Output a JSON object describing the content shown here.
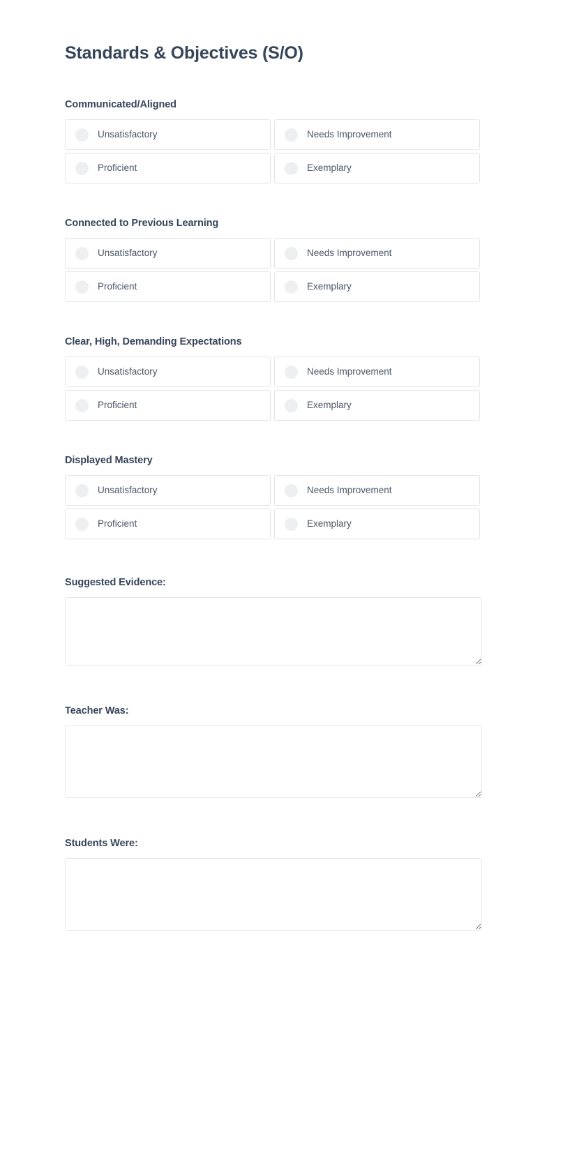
{
  "page": {
    "title": "Standards & Objectives (S/O)",
    "accent_color": "#36455a",
    "border_color": "#e3e5e8",
    "radio_color": "#eeeff1"
  },
  "criteria": [
    {
      "label": "Communicated/Aligned",
      "options": [
        "Unsatisfactory",
        "Needs Improvement",
        "Proficient",
        "Exemplary"
      ]
    },
    {
      "label": "Connected to Previous Learning",
      "options": [
        "Unsatisfactory",
        "Needs Improvement",
        "Proficient",
        "Exemplary"
      ]
    },
    {
      "label": "Clear, High, Demanding Expectations",
      "options": [
        "Unsatisfactory",
        "Needs Improvement",
        "Proficient",
        "Exemplary"
      ]
    },
    {
      "label": "Displayed Mastery",
      "options": [
        "Unsatisfactory",
        "Needs Improvement",
        "Proficient",
        "Exemplary"
      ]
    }
  ],
  "textareas": [
    {
      "label": "Suggested Evidence:",
      "value": ""
    },
    {
      "label": "Teacher Was:",
      "value": ""
    },
    {
      "label": "Students Were:",
      "value": ""
    }
  ]
}
